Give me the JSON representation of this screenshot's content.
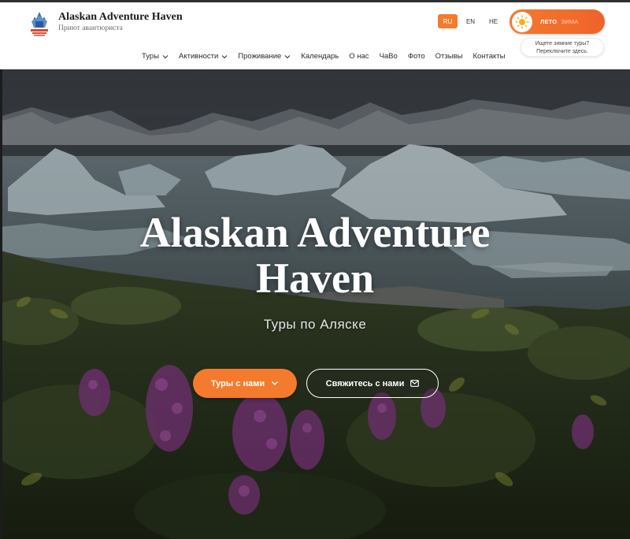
{
  "brand": {
    "title": "Alaskan Adventure Haven",
    "subtitle": "Приют авантюриста"
  },
  "languages": [
    {
      "code": "RU",
      "active": true
    },
    {
      "code": "EN",
      "active": false
    },
    {
      "code": "HE",
      "active": false
    }
  ],
  "season_toggle": {
    "summer_label": "ЛЕТО",
    "winter_label": "ЗИМА",
    "icon": "sun-icon",
    "accent": "#f47b2d"
  },
  "winter_tip": {
    "line1": "Ищете зимние туры?",
    "line2": "Переключите здесь."
  },
  "nav": {
    "items": [
      {
        "label": "Туры",
        "has_dropdown": true
      },
      {
        "label": "Активности",
        "has_dropdown": true
      },
      {
        "label": "Проживание",
        "has_dropdown": true
      },
      {
        "label": "Календарь",
        "has_dropdown": false
      },
      {
        "label": "О нас",
        "has_dropdown": false
      },
      {
        "label": "ЧаВо",
        "has_dropdown": false
      },
      {
        "label": "Фото",
        "has_dropdown": false
      },
      {
        "label": "Отзывы",
        "has_dropdown": false
      },
      {
        "label": "Контакты",
        "has_dropdown": false
      }
    ]
  },
  "hero": {
    "title_line1": "Alaskan Adventure",
    "title_line2": "Haven",
    "subtitle": "Туры по Аляске",
    "primary_button": "Туры с нами",
    "secondary_button": "Свяжитесь с нами"
  }
}
